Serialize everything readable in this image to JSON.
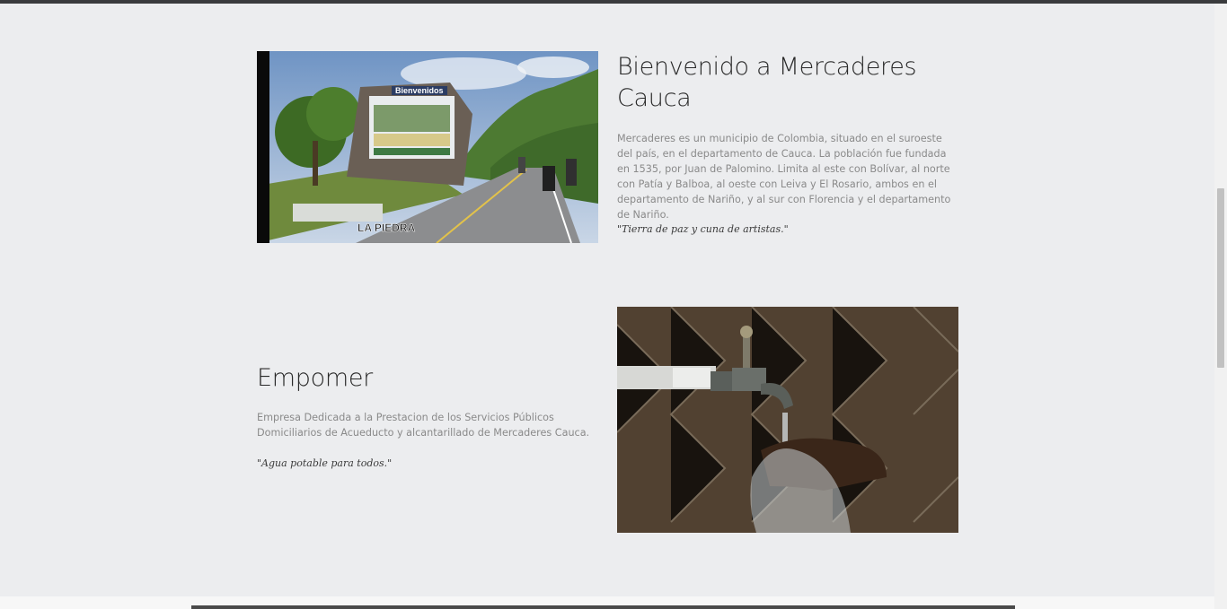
{
  "section1": {
    "image_caption": "LA PIEDRA",
    "sign_text": "Bienvenidos",
    "title": "Bienvenido a Mercaderes Cauca",
    "body": "Mercaderes es un municipio de Colombia, situado en el suroeste del país, en el departamento de Cauca. La población fue fundada en 1535, por Juan de Palomino. Limita al este con Bolívar, al norte con Patía y Balboa, al oeste con Leiva y El Rosario, ambos en el departamento de Nariño, y al sur con Florencia y el departamento de Nariño.",
    "quote": "\"Tierra de paz y cuna de artistas.\""
  },
  "section2": {
    "title": "Empomer",
    "body": "Empresa Dedicada a la Prestacion de los Servicios Públicos Domiciliarios de Acueducto y alcantarillado de Mercaderes Cauca.",
    "quote": "\"Agua potable para todos.\""
  }
}
